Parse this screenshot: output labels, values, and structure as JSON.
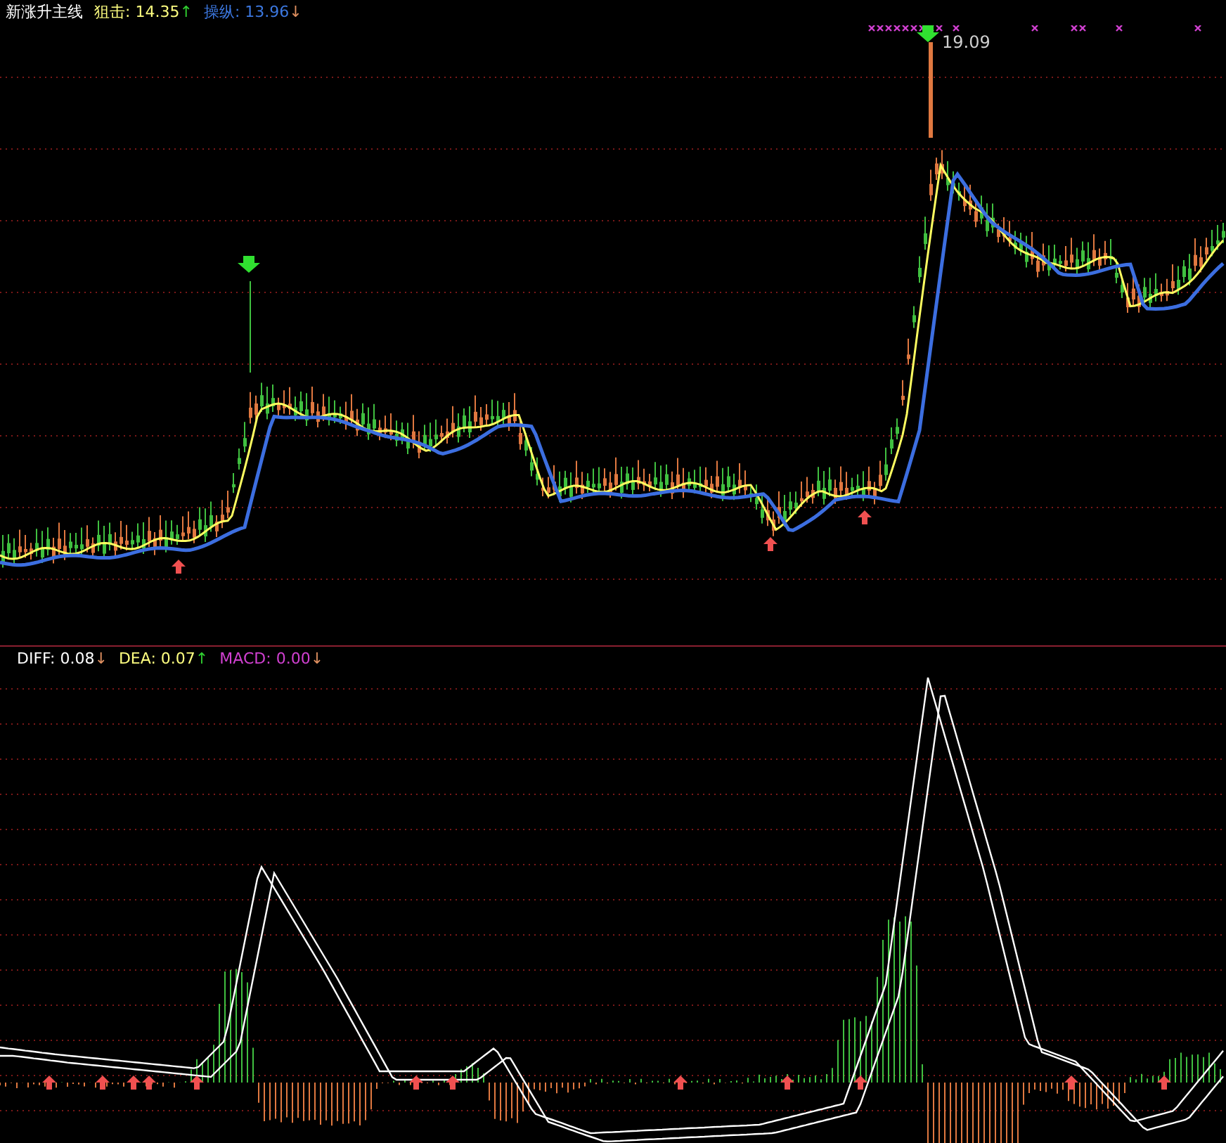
{
  "price_panel": {
    "title": "新涨升主线",
    "indicators": [
      {
        "label": "狙击:",
        "value": "14.35",
        "arrow": {
          "symbol": "↑",
          "color": "#30d030"
        },
        "color": "#ffff80"
      },
      {
        "label": "操纵:",
        "value": "13.96",
        "arrow": {
          "symbol": "↓",
          "color": "#e09060"
        },
        "color": "#3c78e0"
      }
    ],
    "peak_label": "19.09"
  },
  "macd_panel": {
    "indicators": [
      {
        "label": "DIFF:",
        "value": "0.08",
        "arrow": {
          "symbol": "↓",
          "color": "#e09060"
        },
        "color": "#ffffff"
      },
      {
        "label": "DEA:",
        "value": "0.07",
        "arrow": {
          "symbol": "↑",
          "color": "#30d030"
        },
        "color": "#ffff80"
      },
      {
        "label": "MACD:",
        "value": "0.00",
        "arrow": {
          "symbol": "↓",
          "color": "#e09060"
        },
        "color": "#d040d0"
      }
    ]
  }
}
